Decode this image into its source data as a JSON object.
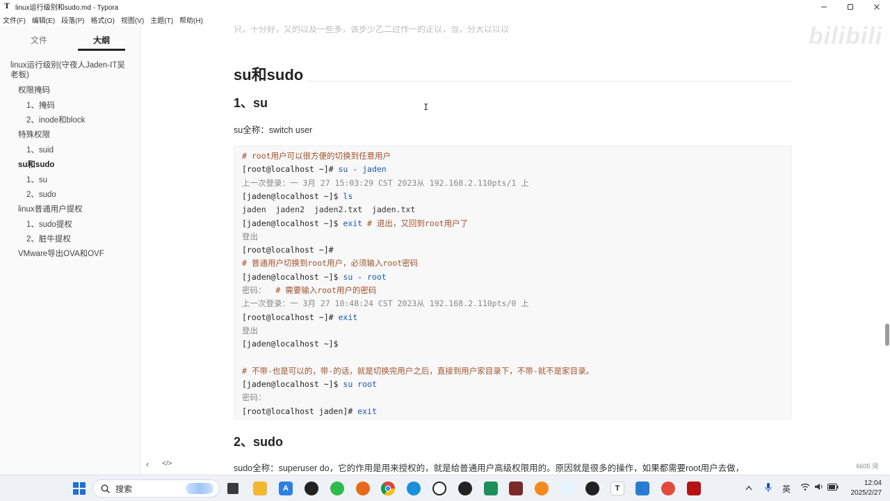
{
  "window": {
    "title": "linux运行级别和sudo.md - Typora",
    "app_icon": "T",
    "controls": [
      "minimize-icon",
      "maximize-icon",
      "close-icon"
    ]
  },
  "menu": [
    "文件(F)",
    "编辑(E)",
    "段落(P)",
    "格式(O)",
    "视图(V)",
    "主题(T)",
    "帮助(H)"
  ],
  "sidebar": {
    "tabs": {
      "files": "文件",
      "outline": "大纲"
    },
    "outline": [
      {
        "label": "linux运行级别(守夜人Jaden-IT吴",
        "level": 1
      },
      {
        "label": "老板)",
        "level": 1
      },
      {
        "label": "权限掩码",
        "level": 2
      },
      {
        "label": "1、掩码",
        "level": 3
      },
      {
        "label": "2、inode和block",
        "level": 3
      },
      {
        "label": "特殊权限",
        "level": 2
      },
      {
        "label": "1、suid",
        "level": 3
      },
      {
        "label": "su和sudo",
        "level": 2,
        "active": true
      },
      {
        "label": "1、su",
        "level": 3
      },
      {
        "label": "2、sudo",
        "level": 3
      },
      {
        "label": "linux普通用户提权",
        "level": 2
      },
      {
        "label": "1、sudo提权",
        "level": 3
      },
      {
        "label": "2、脏牛提权",
        "level": 3
      },
      {
        "label": "VMware导出OVA和OVF",
        "level": 2
      }
    ],
    "footer": {
      "collapse": "‹",
      "source": "</>"
    }
  },
  "editor": {
    "top_partial": "只，十分好，又的以及一些多，该步少乙二过作一的正以，当，分大以以以",
    "watermark": "bilibili",
    "h2": "su和sudo",
    "h3_su": "1、su",
    "su_full": "su全称：switch  user",
    "code_lines": [
      [
        [
          "c-comment",
          "# root用户可以很方便的切换到任意用户"
        ]
      ],
      [
        [
          "c-prompt",
          "[root@localhost ~]# "
        ],
        [
          "c-cmd",
          "su - jaden"
        ]
      ],
      [
        [
          "c-faint",
          "上一次登录：一 3月 27 15:03:29 CST 2023从 192.168.2.110pts/1 上"
        ]
      ],
      [
        [
          "c-prompt",
          "[jaden@localhost ~]$ "
        ],
        [
          "c-cmd",
          "ls"
        ]
      ],
      [
        [
          "c-out",
          "jaden  jaden2  jaden2.txt  jaden.txt"
        ]
      ],
      [
        [
          "c-prompt",
          "[jaden@localhost ~]$ "
        ],
        [
          "c-cmd",
          "exit "
        ],
        [
          "c-comment",
          "# 退出，又回到root用户了"
        ]
      ],
      [
        [
          "c-faint",
          "登出"
        ]
      ],
      [
        [
          "c-prompt",
          "[root@localhost ~]#"
        ]
      ],
      [
        [
          "c-comment",
          "# 普通用户切换到root用户，必须输入root密码"
        ]
      ],
      [
        [
          "c-prompt",
          "[jaden@localhost ~]$ "
        ],
        [
          "c-cmd",
          "su - root"
        ]
      ],
      [
        [
          "c-faint",
          "密码：  "
        ],
        [
          "c-comment",
          "# 需要输入root用户的密码"
        ]
      ],
      [
        [
          "c-faint",
          "上一次登录：一 3月 27 10:48:24 CST 2023从 192.168.2.110pts/0 上"
        ]
      ],
      [
        [
          "c-prompt",
          "[root@localhost ~]# "
        ],
        [
          "c-cmd",
          "exit"
        ]
      ],
      [
        [
          "c-faint",
          "登出"
        ]
      ],
      [
        [
          "c-prompt",
          "[jaden@localhost ~]$"
        ]
      ],
      [
        [
          "c-out",
          ""
        ]
      ],
      [
        [
          "c-comment",
          "# 不带-也是可以的，带-的话，就是切换完用户之后，直接到用户家目录下，不带-就不是家目录。"
        ]
      ],
      [
        [
          "c-prompt",
          "[jaden@localhost ~]$ "
        ],
        [
          "c-cmd",
          "su root"
        ]
      ],
      [
        [
          "c-faint",
          "密码："
        ]
      ],
      [
        [
          "c-prompt",
          "[root@localhost jaden]# "
        ],
        [
          "c-cmd",
          "exit"
        ]
      ]
    ],
    "h3_sudo": "2、sudo",
    "sudo_full": "sudo全称：superuser do，它的作用是用来授权的，就是给普通用户高级权限用的。原因就是很多的操作，如果都需要root用户去做，",
    "word_count": "6605 词"
  },
  "taskbar": {
    "search_placeholder": "搜索",
    "ime": "英",
    "time": "12:04",
    "date": "2025/2/27"
  },
  "colors": {
    "comment": "#a0522d",
    "command": "#1a56b0",
    "sidebar_bg": "#fafafa",
    "taskbar_bg": "#eef1f6"
  }
}
